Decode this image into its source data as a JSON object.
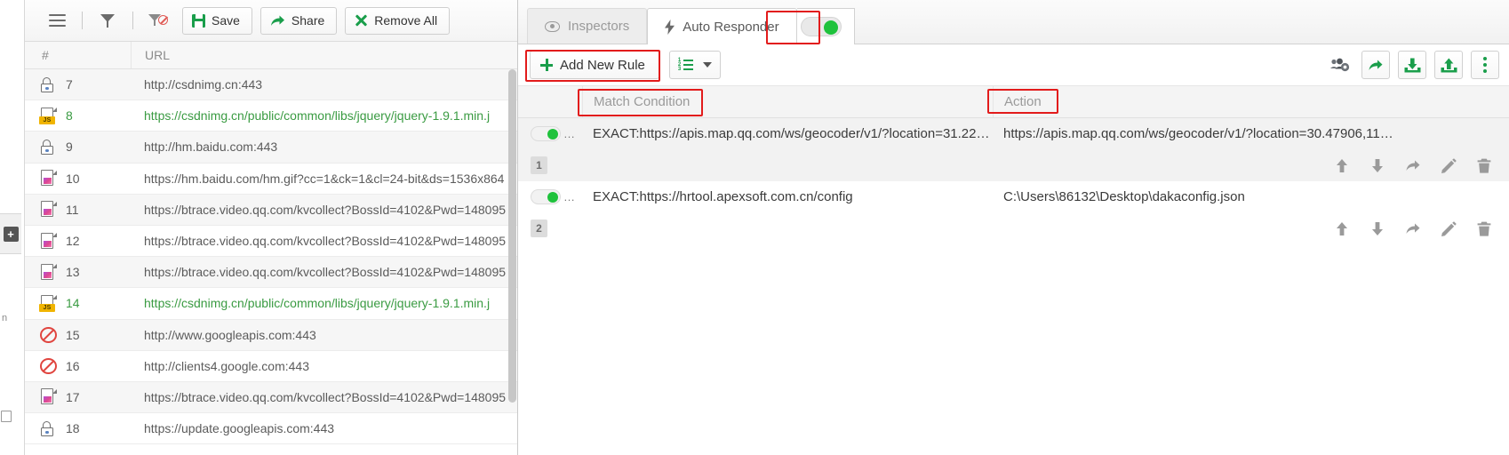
{
  "session_panel": {
    "toolbar": {
      "menu_icon": "hamburger-icon",
      "filter_icon": "funnel-icon",
      "clear_filter_icon": "funnel-disabled-icon",
      "save_label": "Save",
      "share_label": "Share",
      "remove_all_label": "Remove All"
    },
    "columns": {
      "num": "#",
      "url": "URL"
    },
    "rows": [
      {
        "id": "7",
        "icon": "lock-icon",
        "url": "http://csdnimg.cn:443",
        "highlight": false
      },
      {
        "id": "8",
        "icon": "js-file-icon",
        "url": "https://csdnimg.cn/public/common/libs/jquery/jquery-1.9.1.min.j",
        "highlight": true
      },
      {
        "id": "9",
        "icon": "lock-icon",
        "url": "http://hm.baidu.com:443",
        "highlight": false
      },
      {
        "id": "10",
        "icon": "image-file-icon",
        "url": "https://hm.baidu.com/hm.gif?cc=1&ck=1&cl=24-bit&ds=1536x864",
        "highlight": false
      },
      {
        "id": "11",
        "icon": "image-file-icon",
        "url": "https://btrace.video.qq.com/kvcollect?BossId=4102&Pwd=148095",
        "highlight": false
      },
      {
        "id": "12",
        "icon": "image-file-icon",
        "url": "https://btrace.video.qq.com/kvcollect?BossId=4102&Pwd=148095",
        "highlight": false
      },
      {
        "id": "13",
        "icon": "image-file-icon",
        "url": "https://btrace.video.qq.com/kvcollect?BossId=4102&Pwd=148095",
        "highlight": false
      },
      {
        "id": "14",
        "icon": "js-file-icon",
        "url": "https://csdnimg.cn/public/common/libs/jquery/jquery-1.9.1.min.j",
        "highlight": true
      },
      {
        "id": "15",
        "icon": "blocked-icon",
        "url": "http://www.googleapis.com:443",
        "highlight": false
      },
      {
        "id": "16",
        "icon": "blocked-icon",
        "url": "http://clients4.google.com:443",
        "highlight": false
      },
      {
        "id": "17",
        "icon": "image-file-icon",
        "url": "https://btrace.video.qq.com/kvcollect?BossId=4102&Pwd=148095",
        "highlight": false
      },
      {
        "id": "18",
        "icon": "lock-icon",
        "url": "https://update.googleapis.com:443",
        "highlight": false
      }
    ]
  },
  "right_panel": {
    "tabs": [
      {
        "label": "Inspectors",
        "icon": "eye-icon",
        "active": false
      },
      {
        "label": "Auto Responder",
        "icon": "bolt-icon",
        "active": true
      }
    ],
    "enable_toggle": {
      "name": "auto-responder-enable-toggle",
      "state": "on",
      "color": "#1fc23c"
    },
    "toolbar": {
      "add_rule_label": "Add New Rule",
      "list_dropdown_icon": "ordered-list-icon",
      "group_settings_icon": "group-settings-icon",
      "share_icon": "share-icon",
      "import_icon": "import-icon",
      "export_icon": "export-icon",
      "more_icon": "more-vertical-icon"
    },
    "grid": {
      "columns": {
        "match": "Match Condition",
        "action": "Action"
      },
      "rules": [
        {
          "index": "1",
          "enabled": "on",
          "match": "EXACT:https://apis.map.qq.com/ws/geocoder/v1/?location=31.22…",
          "action": "https://apis.map.qq.com/ws/geocoder/v1/?location=30.47906,11…",
          "row_actions": [
            "move-up-icon",
            "move-down-icon",
            "share-icon",
            "edit-icon",
            "delete-icon"
          ]
        },
        {
          "index": "2",
          "enabled": "on",
          "match": "EXACT:https://hrtool.apexsoft.com.cn/config",
          "action": "C:\\Users\\86132\\Desktop\\dakaconfig.json",
          "row_actions": [
            "move-up-icon",
            "move-down-icon",
            "share-icon",
            "edit-icon",
            "delete-icon"
          ]
        }
      ]
    }
  },
  "annotations": {
    "highlight_color": "#e21b1b",
    "boxes": [
      "enable-toggle",
      "add-new-rule-button",
      "match-condition-header",
      "action-header"
    ]
  }
}
